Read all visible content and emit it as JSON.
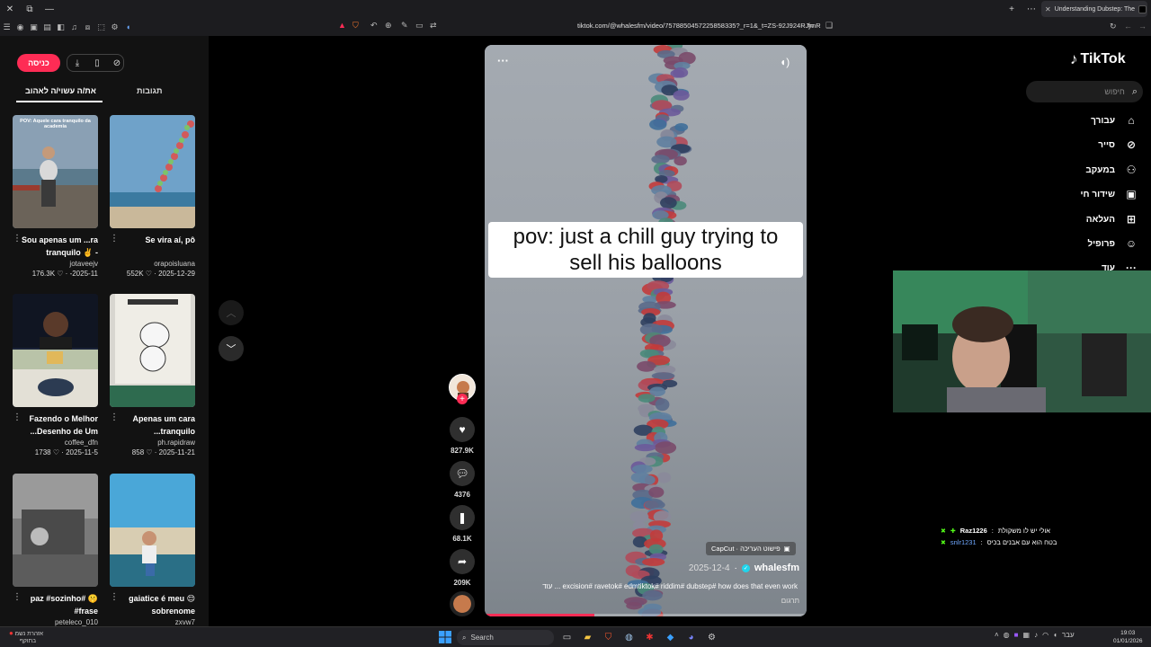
{
  "browser": {
    "tab_title": "Understanding Dubstep: The",
    "url": "tiktok.com/@whalesfm/video/7578850457225858335?_r=1&_t=ZS-92J924RJjmR"
  },
  "left_panel": {
    "login_label": "כניסה",
    "tab_you_may_like": "את/ה עשוי/ה לאהוב",
    "tab_comments": "תגובות",
    "cards": [
      {
        "caption": "POV: Aquele cara tranquilo da academia",
        "title": "Sou apenas um ...ra tranquilo ✌️ -",
        "author": "jotaveejv",
        "date": "-2025-11",
        "likes": "176.3K"
      },
      {
        "caption": "",
        "title": "Se vira aí, pô",
        "author": "orapoisluana",
        "date": "2025-12-29",
        "likes": "552K"
      },
      {
        "caption": "",
        "title": "Fazendo o Melhor ...Desenho de Um",
        "author": "coffee_dfn",
        "date": "2025-11-5",
        "likes": "1738"
      },
      {
        "caption": "",
        "title": "Apenas um cara ...tranquilo",
        "author": "ph.rapidraw",
        "date": "2025-11-21",
        "likes": "858"
      },
      {
        "caption": "",
        "title": "paz #sozinho# 🤫 #frase",
        "author": "peteleco_010",
        "date": "",
        "likes": ""
      },
      {
        "caption": "",
        "title": "gaiatice é meu 😌 sobrenome",
        "author": "zxvw7",
        "date": "",
        "likes": ""
      }
    ]
  },
  "video": {
    "overlay_text": "pov: just a chill guy trying to sell his balloons",
    "capcut_label": "CapCut · פישוט העריכה",
    "author": "whalesfm",
    "date": "2025-12-4",
    "description": "עוד ... excision# ravetok# edmtiktok# riddim# dubstep# how does that even work",
    "translate_label": "תרגום",
    "progress": 0.34
  },
  "actions": {
    "likes": "827.9K",
    "comments": "4376",
    "saves": "68.1K",
    "shares": "209K"
  },
  "sidebar": {
    "logo_text": "TikTok",
    "search_placeholder": "חיפוש",
    "items": [
      {
        "label": "עבורך",
        "icon": "home-icon"
      },
      {
        "label": "סייר",
        "icon": "compass-icon"
      },
      {
        "label": "במעקב",
        "icon": "following-icon"
      },
      {
        "label": "שידור חי",
        "icon": "live-icon"
      },
      {
        "label": "העלאה",
        "icon": "upload-icon"
      },
      {
        "label": "פרופיל",
        "icon": "profile-icon"
      },
      {
        "label": "עוד",
        "icon": "more-icon"
      }
    ]
  },
  "chat": [
    {
      "user": "Raz1226",
      "message": "אולי יש לו משקולת"
    },
    {
      "user": "snlr1231",
      "message": "בטח הוא עם אבנים בכיס"
    }
  ],
  "taskbar": {
    "weather_line1": "אזהרת נשמ",
    "weather_line2": "בתוקף",
    "search_label": "Search",
    "time": "19:03",
    "date": "01/01/2026",
    "lang": "עבר"
  },
  "colors": {
    "accent": "#fe2c55",
    "verified": "#20d5ec",
    "chat_badge": "#53fc18"
  }
}
